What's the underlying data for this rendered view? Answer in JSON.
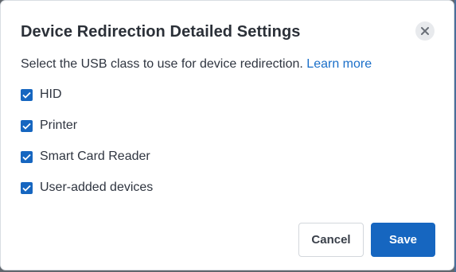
{
  "dialog": {
    "title": "Device Redirection Detailed Settings",
    "close_icon": "close-icon",
    "description": "Select the USB class to use for device redirection.",
    "learn_more": "Learn more",
    "options": [
      {
        "label": "HID",
        "checked": true
      },
      {
        "label": "Printer",
        "checked": true
      },
      {
        "label": "Smart Card Reader",
        "checked": true
      },
      {
        "label": "User-added devices",
        "checked": true
      }
    ],
    "cancel_label": "Cancel",
    "save_label": "Save"
  },
  "colors": {
    "accent": "#1666c0",
    "link": "#1a6fc9",
    "text": "#2f3540"
  }
}
